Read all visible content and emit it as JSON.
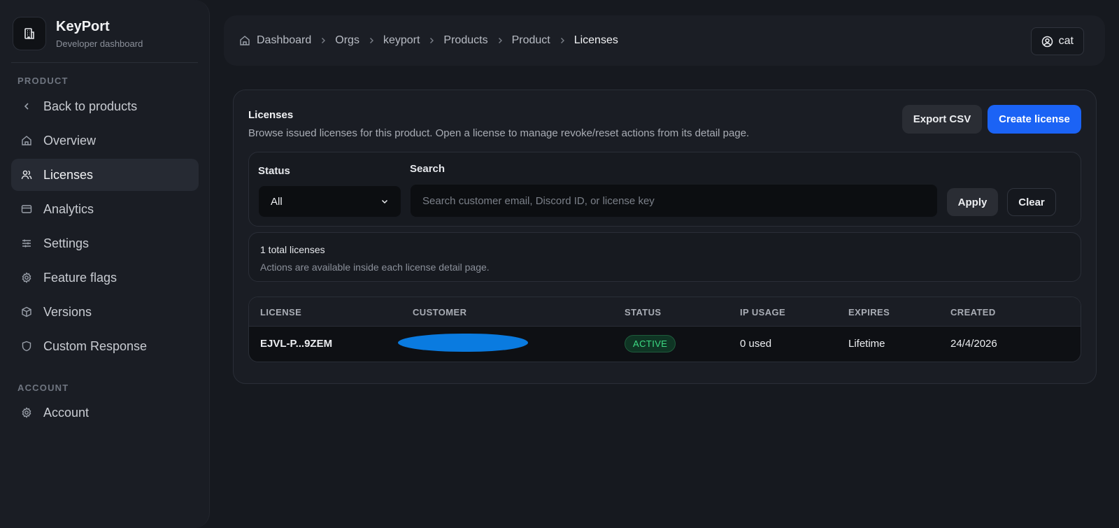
{
  "brand": {
    "title": "KeyPort",
    "subtitle": "Developer dashboard"
  },
  "sidebar": {
    "product_section": "PRODUCT",
    "account_section": "ACCOUNT",
    "items": [
      {
        "label": "Back to products",
        "icon": "chevron-left-icon"
      },
      {
        "label": "Overview",
        "icon": "home-icon"
      },
      {
        "label": "Licenses",
        "icon": "users-icon",
        "active": true
      },
      {
        "label": "Analytics",
        "icon": "card-icon"
      },
      {
        "label": "Settings",
        "icon": "sliders-icon"
      },
      {
        "label": "Feature flags",
        "icon": "gear-icon"
      },
      {
        "label": "Versions",
        "icon": "box-icon"
      },
      {
        "label": "Custom Response",
        "icon": "shield-icon"
      }
    ],
    "account_items": [
      {
        "label": "Account",
        "icon": "gear-icon"
      }
    ]
  },
  "breadcrumb": [
    "Dashboard",
    "Orgs",
    "keyport",
    "Products",
    "Product",
    "Licenses"
  ],
  "user": {
    "name": "cat"
  },
  "licenses_card": {
    "title": "Licenses",
    "description": "Browse issued licenses for this product. Open a license to manage revoke/reset actions from its detail page.",
    "export_label": "Export CSV",
    "create_label": "Create license"
  },
  "filters": {
    "status_label": "Status",
    "status_value": "All",
    "search_label": "Search",
    "search_placeholder": "Search customer email, Discord ID, or license key",
    "search_value": "",
    "apply_label": "Apply",
    "clear_label": "Clear"
  },
  "summary": {
    "count_text": "1 total licenses",
    "note": "Actions are available inside each license detail page."
  },
  "table": {
    "columns": [
      "LICENSE",
      "CUSTOMER",
      "STATUS",
      "IP USAGE",
      "EXPIRES",
      "CREATED"
    ],
    "rows": [
      {
        "license": "EJVL-P...9ZEM",
        "customer": "",
        "status": "ACTIVE",
        "ip_usage": "0 used",
        "expires": "Lifetime",
        "created": "24/4/2026"
      }
    ]
  },
  "colors": {
    "accent": "#1b63f5",
    "active_status": "#3ddc84",
    "redaction": "#0a7be0"
  }
}
